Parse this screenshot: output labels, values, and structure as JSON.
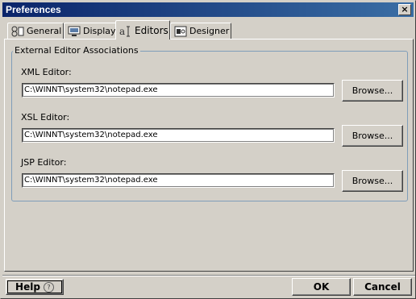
{
  "window": {
    "title": "Preferences",
    "close_symbol": "×"
  },
  "tabs": [
    {
      "label": "General",
      "icon": "general-icon"
    },
    {
      "label": "Display",
      "icon": "monitor-icon"
    },
    {
      "label": "Editors",
      "icon": "editor-icon",
      "active": true
    },
    {
      "label": "Designer",
      "icon": "designer-icon"
    }
  ],
  "group": {
    "title": "External Editor Associations",
    "fields": [
      {
        "label": "XML Editor:",
        "value": "C:\\WINNT\\system32\\notepad.exe",
        "button": "Browse..."
      },
      {
        "label": "XSL Editor:",
        "value": "C:\\WINNT\\system32\\notepad.exe",
        "button": "Browse..."
      },
      {
        "label": "JSP Editor:",
        "value": "C:\\WINNT\\system32\\notepad.exe",
        "button": "Browse..."
      }
    ]
  },
  "footer": {
    "help": "Help",
    "help_icon_glyph": "?",
    "ok": "OK",
    "cancel": "Cancel"
  },
  "colors": {
    "title_start": "#0a246a",
    "title_end": "#3a6ea5",
    "face": "#d4d0c8"
  }
}
